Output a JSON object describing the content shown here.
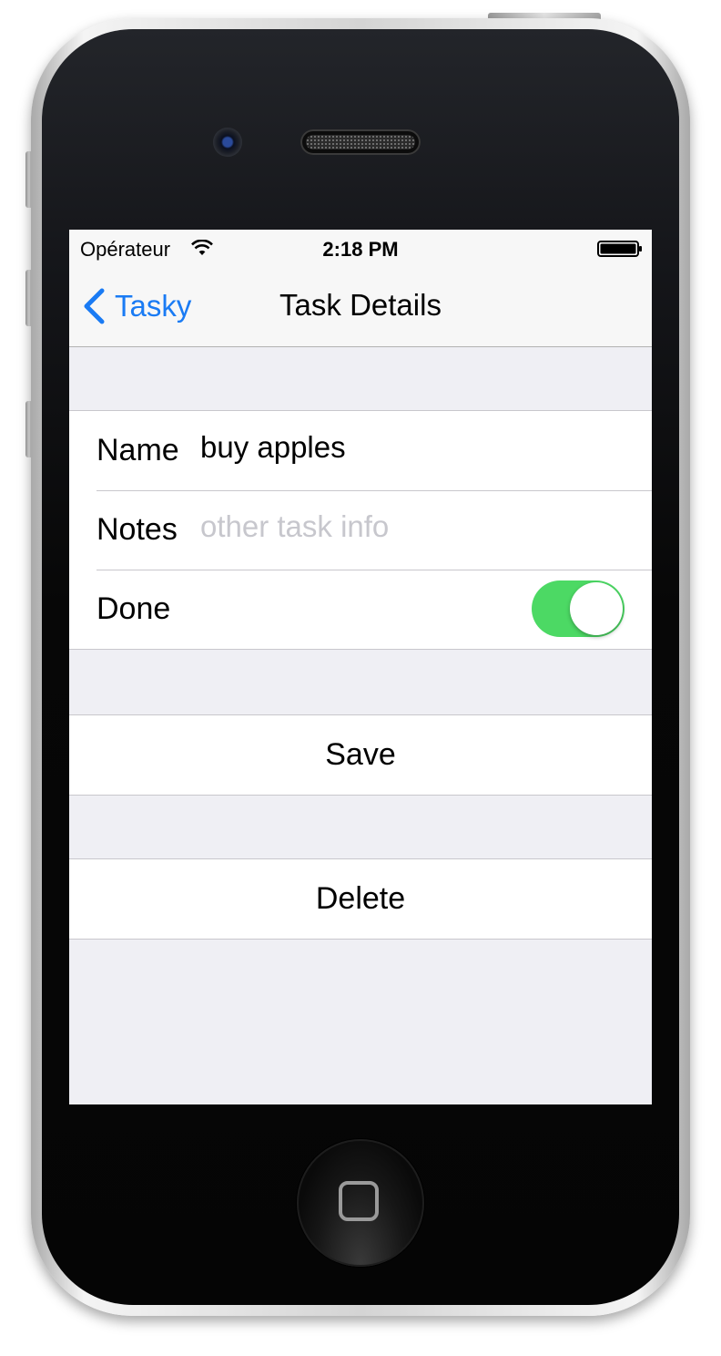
{
  "status_bar": {
    "carrier": "Opérateur",
    "time": "2:18 PM"
  },
  "nav_bar": {
    "back_label": "Tasky",
    "title": "Task Details"
  },
  "form": {
    "name_label": "Name",
    "name_value": "buy apples",
    "notes_label": "Notes",
    "notes_value": "",
    "notes_placeholder": "other task info",
    "done_label": "Done",
    "done_checked": true
  },
  "actions": {
    "save_label": "Save",
    "delete_label": "Delete"
  },
  "colors": {
    "accent": "#1a7bf4",
    "switch_on": "#4cd964",
    "grouped_background": "#efeff4",
    "bar_background": "#f7f7f7"
  },
  "icons": [
    "wifi-icon",
    "battery-icon",
    "back-chevron-icon",
    "home-button-icon"
  ]
}
